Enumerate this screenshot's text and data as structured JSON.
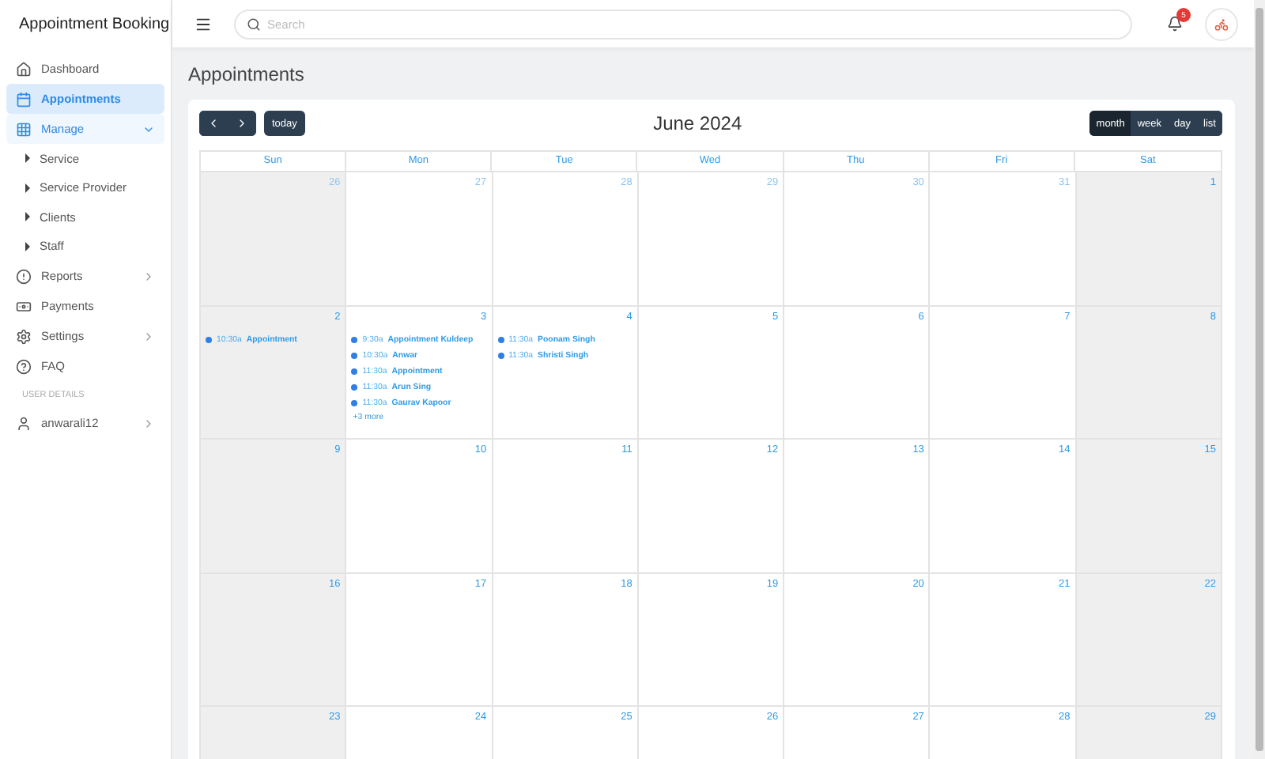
{
  "app": {
    "title": "Appointment Booking"
  },
  "sidebar": {
    "items": [
      {
        "label": "Dashboard",
        "kind": "home",
        "selected": false
      },
      {
        "label": "Appointments",
        "kind": "calendar",
        "selected": true
      },
      {
        "label": "Manage",
        "kind": "grid",
        "selected": false,
        "expanded": true,
        "children": [
          {
            "label": "Service"
          },
          {
            "label": "Service Provider"
          },
          {
            "label": "Clients"
          },
          {
            "label": "Staff"
          }
        ]
      },
      {
        "label": "Reports",
        "kind": "alert",
        "selected": false,
        "expanded": false
      },
      {
        "label": "Payments",
        "kind": "money",
        "selected": false
      },
      {
        "label": "Settings",
        "kind": "gear",
        "selected": false,
        "expanded": false
      },
      {
        "label": "FAQ",
        "kind": "help",
        "selected": false
      }
    ],
    "section_label": "USER DETAILS",
    "user": {
      "label": "anwarali12"
    }
  },
  "header": {
    "search": {
      "placeholder": "Search"
    },
    "notifications": {
      "badge": "5"
    }
  },
  "page": {
    "title": "Appointments"
  },
  "calendar": {
    "title": "June 2024",
    "today_button": "today",
    "views": [
      {
        "label": "month",
        "selected": true
      },
      {
        "label": "week",
        "selected": false
      },
      {
        "label": "day",
        "selected": false
      },
      {
        "label": "list",
        "selected": false
      }
    ],
    "weekdays": [
      "Sun",
      "Mon",
      "Tue",
      "Wed",
      "Thu",
      "Fri",
      "Sat"
    ],
    "weeks": [
      [
        {
          "day": "26",
          "other_month": true
        },
        {
          "day": "27",
          "other_month": true
        },
        {
          "day": "28",
          "other_month": true
        },
        {
          "day": "29",
          "other_month": true
        },
        {
          "day": "30",
          "other_month": true
        },
        {
          "day": "31",
          "other_month": true
        },
        {
          "day": "1",
          "other_month": false
        }
      ],
      [
        {
          "day": "2",
          "other_month": false,
          "events": [
            {
              "time": "10:30a",
              "title": "Appointment"
            }
          ]
        },
        {
          "day": "3",
          "other_month": false,
          "events": [
            {
              "time": "9:30a",
              "title": "Appointment Kuldeep"
            },
            {
              "time": "10:30a",
              "title": "Anwar"
            },
            {
              "time": "11:30a",
              "title": "Appointment"
            },
            {
              "time": "11:30a",
              "title": "Arun Sing"
            },
            {
              "time": "11:30a",
              "title": "Gaurav Kapoor"
            }
          ],
          "more": "+3 more"
        },
        {
          "day": "4",
          "other_month": false,
          "events": [
            {
              "time": "11:30a",
              "title": "Poonam Singh"
            },
            {
              "time": "11:30a",
              "title": "Shristi Singh"
            }
          ]
        },
        {
          "day": "5",
          "other_month": false
        },
        {
          "day": "6",
          "other_month": false
        },
        {
          "day": "7",
          "other_month": false
        },
        {
          "day": "8",
          "other_month": false
        }
      ],
      [
        {
          "day": "9",
          "other_month": false
        },
        {
          "day": "10",
          "other_month": false
        },
        {
          "day": "11",
          "other_month": false
        },
        {
          "day": "12",
          "other_month": false
        },
        {
          "day": "13",
          "other_month": false
        },
        {
          "day": "14",
          "other_month": false
        },
        {
          "day": "15",
          "other_month": false
        }
      ],
      [
        {
          "day": "16",
          "other_month": false
        },
        {
          "day": "17",
          "other_month": false
        },
        {
          "day": "18",
          "other_month": false
        },
        {
          "day": "19",
          "other_month": false
        },
        {
          "day": "20",
          "other_month": false
        },
        {
          "day": "21",
          "other_month": false
        },
        {
          "day": "22",
          "other_month": false
        }
      ],
      [
        {
          "day": "23",
          "other_month": false
        },
        {
          "day": "24",
          "other_month": false
        },
        {
          "day": "25",
          "other_month": false
        },
        {
          "day": "26",
          "other_month": false
        },
        {
          "day": "27",
          "other_month": false
        },
        {
          "day": "28",
          "other_month": false
        },
        {
          "day": "29",
          "other_month": false
        }
      ]
    ]
  }
}
